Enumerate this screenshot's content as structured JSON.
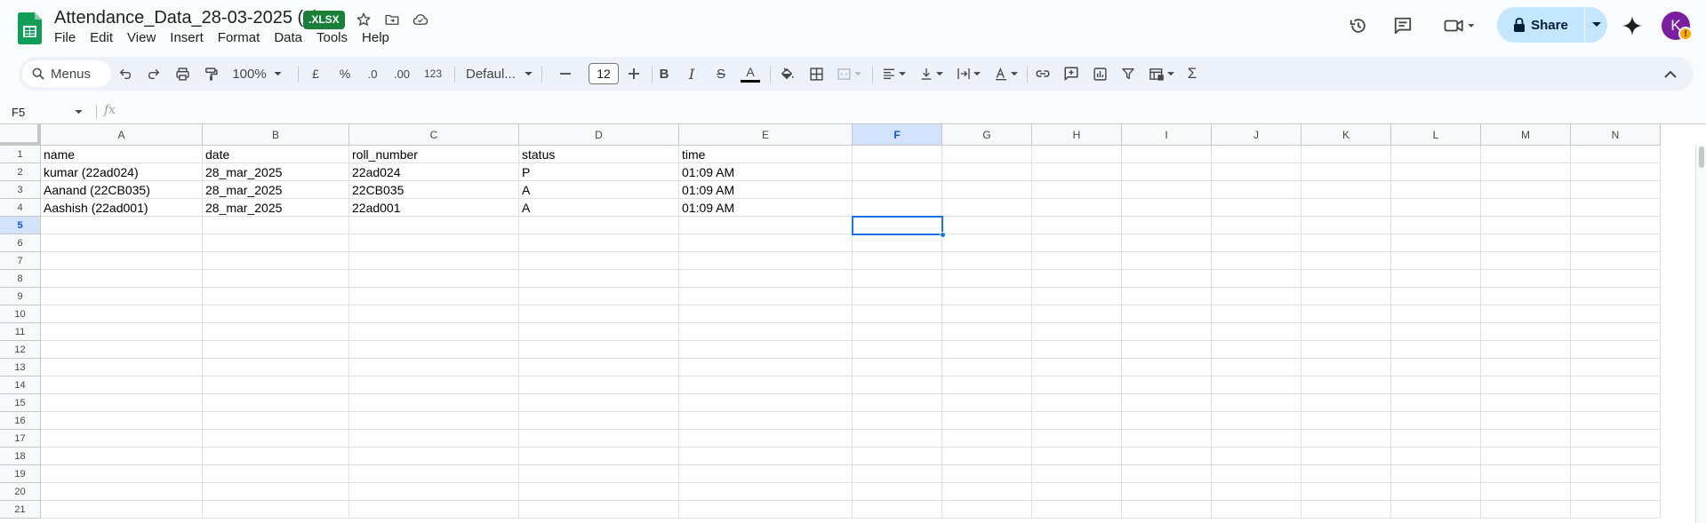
{
  "doc": {
    "title": "Attendance_Data_28-03-2025 (1)",
    "format_badge": ".XLSX"
  },
  "menu": [
    "File",
    "Edit",
    "View",
    "Insert",
    "Format",
    "Data",
    "Tools",
    "Help"
  ],
  "header": {
    "share_label": "Share",
    "avatar_initial": "K",
    "avatar_badge": "!"
  },
  "toolbar": {
    "search_label": "Menus",
    "zoom": "100%",
    "currency": "£",
    "percent": "%",
    "decimal_decrease": ".0",
    "decimal_increase": ".00",
    "number_format": "123",
    "font_name": "Defaul...",
    "font_size": "12",
    "bold": "B",
    "italic": "I",
    "strikethrough": "S",
    "text_color": "A",
    "sum": "Σ"
  },
  "formula_bar": {
    "name_box": "F5",
    "fx_label": "fx",
    "value": ""
  },
  "sheet": {
    "columns": [
      "A",
      "B",
      "C",
      "D",
      "E",
      "F",
      "G",
      "H",
      "I",
      "J",
      "K",
      "L",
      "M",
      "N"
    ],
    "row_numbers": [
      "1",
      "2",
      "3",
      "4",
      "5",
      "6",
      "7",
      "8",
      "9",
      "10",
      "11",
      "12",
      "13",
      "14",
      "15",
      "16",
      "17",
      "18",
      "19",
      "20",
      "21"
    ],
    "rows": [
      [
        "name",
        "date",
        "roll_number",
        "status",
        "time"
      ],
      [
        "kumar (22ad024)",
        "28_mar_2025",
        "22ad024",
        "P",
        "01:09 AM"
      ],
      [
        "Aanand (22CB035)",
        "28_mar_2025",
        "22CB035",
        "A",
        "01:09 AM"
      ],
      [
        "Aashish (22ad001)",
        "28_mar_2025",
        "22ad001",
        "A",
        "01:09 AM"
      ]
    ],
    "active_cell": "F5",
    "active_column": "F",
    "active_row": "5"
  },
  "colors": {
    "accent": "#1a73e8",
    "share_bg": "#c2e7ff",
    "xlsx_badge": "#188038",
    "sheets_green": "#0f9d58",
    "avatar": "#7b1fa2"
  }
}
